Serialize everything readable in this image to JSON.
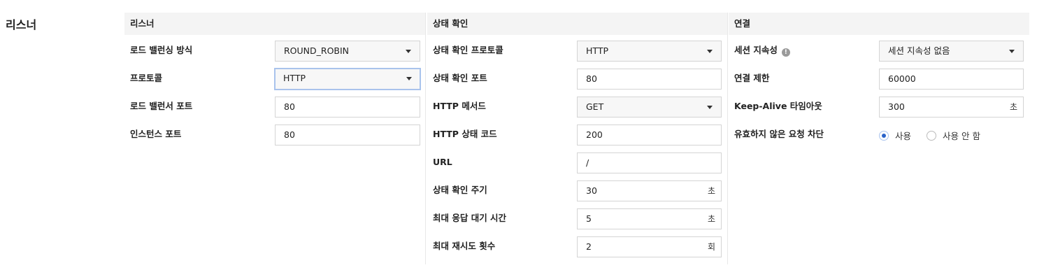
{
  "page": {
    "title": "리스너"
  },
  "listener": {
    "header": "리스너",
    "fields": [
      {
        "label": "로드 밸런싱 방식",
        "value": "ROUND_ROBIN",
        "type": "select"
      },
      {
        "label": "프로토콜",
        "value": "HTTP",
        "type": "select",
        "focused": true
      },
      {
        "label": "로드 밸런서 포트",
        "value": "80",
        "type": "input"
      },
      {
        "label": "인스턴스 포트",
        "value": "80",
        "type": "input"
      }
    ]
  },
  "health_check": {
    "header": "상태 확인",
    "fields": [
      {
        "label": "상태 확인 프로토콜",
        "value": "HTTP",
        "type": "select"
      },
      {
        "label": "상태 확인 포트",
        "value": "80",
        "type": "input"
      },
      {
        "label": "HTTP 메서드",
        "value": "GET",
        "type": "select"
      },
      {
        "label": "HTTP 상태 코드",
        "value": "200",
        "type": "input"
      },
      {
        "label": "URL",
        "value": "/",
        "type": "input"
      },
      {
        "label": "상태 확인 주기",
        "value": "30",
        "type": "input",
        "unit": "초"
      },
      {
        "label": "최대 응답 대기 시간",
        "value": "5",
        "type": "input",
        "unit": "초"
      },
      {
        "label": "최대 재시도 횟수",
        "value": "2",
        "type": "input",
        "unit": "회"
      }
    ]
  },
  "connection": {
    "header": "연결",
    "session_persistence": {
      "label": "세션 지속성",
      "value": "세션 지속성 없음",
      "icon": "info-icon"
    },
    "connection_limit": {
      "label": "연결 제한",
      "value": "60000"
    },
    "keepalive_timeout": {
      "label": "Keep-Alive 타임아웃",
      "value": "300",
      "unit": "초"
    },
    "block_invalid_requests": {
      "label": "유효하지 않은 요청 차단",
      "options": [
        {
          "label": "사용",
          "selected": true
        },
        {
          "label": "사용 안 함",
          "selected": false
        }
      ]
    }
  }
}
